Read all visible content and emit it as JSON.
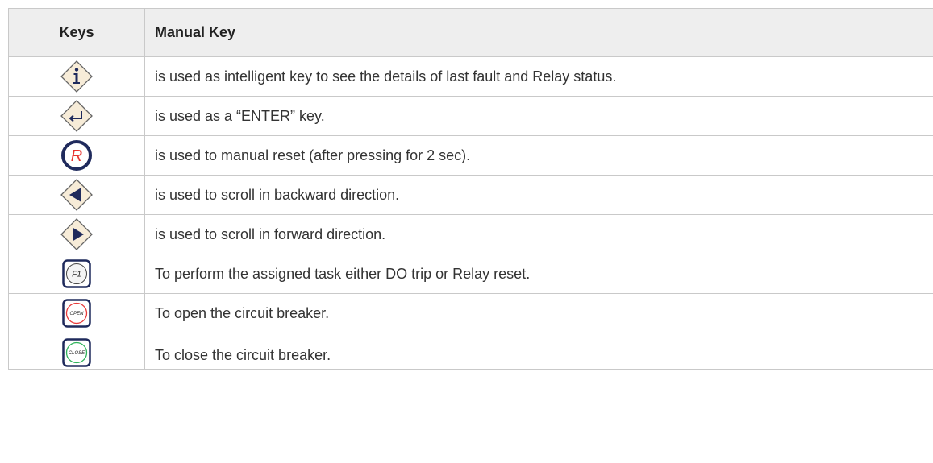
{
  "table": {
    "headers": {
      "keys": "Keys",
      "manual_key": "Manual Key"
    },
    "rows": [
      {
        "icon": "info-key-icon",
        "description": "is used as intelligent key to see the details of last fault and Relay status."
      },
      {
        "icon": "enter-key-icon",
        "description": "is used as a “ENTER” key."
      },
      {
        "icon": "reset-key-icon",
        "key_label": "R",
        "description": "is used to manual reset (after pressing for 2 sec)."
      },
      {
        "icon": "left-arrow-key-icon",
        "description": "is used to scroll in backward direction."
      },
      {
        "icon": "right-arrow-key-icon",
        "description": "is used to scroll in forward direction."
      },
      {
        "icon": "f1-key-icon",
        "key_label": "F1",
        "description": "To perform the assigned task either DO trip or Relay reset."
      },
      {
        "icon": "open-key-icon",
        "key_label": "OPEN",
        "description": "To open the circuit breaker."
      },
      {
        "icon": "close-key-icon",
        "key_label": "CLOSE",
        "description": "To close the circuit breaker."
      }
    ]
  },
  "colors": {
    "key_fill": "#f7ecd8",
    "navy": "#1f2a5c",
    "reset_red": "#e8322f",
    "open_red": "#e83a3a",
    "close_green": "#2fb35a",
    "header_bg": "#eeeeee",
    "border": "#c9c9c9"
  }
}
